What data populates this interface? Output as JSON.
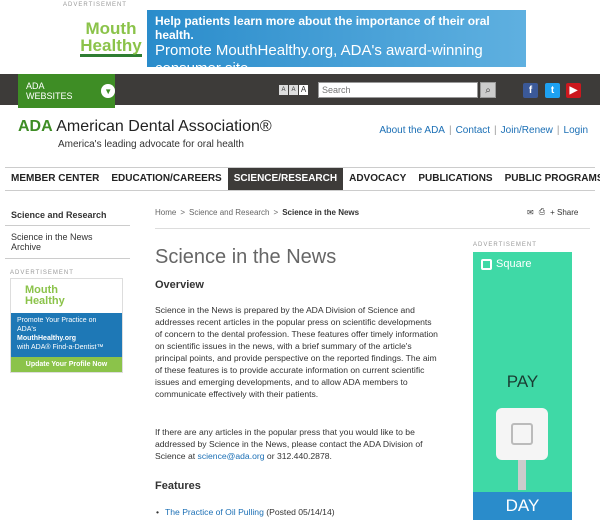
{
  "top_ad": {
    "label": "ADVERTISEMENT",
    "logo_line1": "Mouth",
    "logo_line2": "Healthy",
    "tm": "TM",
    "line1": "Help patients learn more about the importance of their oral health.",
    "line2": "Promote MouthHealthy.org, ADA's award-winning consumer site."
  },
  "utility": {
    "websites_label": "ADA WEBSITES",
    "text_sizes": [
      "A",
      "A",
      "A"
    ],
    "search_placeholder": "Search",
    "social": [
      "f",
      "t",
      "▶"
    ]
  },
  "header": {
    "logo_short": "ADA",
    "logo_name": "American Dental Association®",
    "tagline": "America's leading advocate for oral health",
    "links": [
      "About the ADA",
      "Contact",
      "Join/Renew",
      "Login"
    ]
  },
  "nav": {
    "items": [
      "MEMBER CENTER",
      "EDUCATION/CAREERS",
      "SCIENCE/RESEARCH",
      "ADVOCACY",
      "PUBLICATIONS",
      "PUBLIC PROGRAMS"
    ],
    "active_index": 2
  },
  "sidebar": {
    "title": "Science and Research",
    "items": [
      "Science in the News Archive"
    ]
  },
  "left_ad": {
    "label": "ADVERTISEMENT",
    "logo_line1": "Mouth",
    "logo_line2": "Healthy",
    "body1": "Promote Your Practice on ADA's",
    "body2": "MouthHealthy.org",
    "body3": "with ADA® Find-a-Dentist™",
    "cta": "Update Your Profile Now"
  },
  "breadcrumb": [
    "Home",
    "Science and Research",
    "Science in the News"
  ],
  "page_tools": {
    "share_label": "Share"
  },
  "content": {
    "title": "Science in the News",
    "overview_heading": "Overview",
    "overview_text": "Science in the News is prepared by the ADA Division of Science and addresses recent articles in the popular press on scientific developments of concern to the dental profession. These features offer timely information on scientific issues in the news, with a brief summary of the article's principal points, and provide perspective on the reported findings. The aim of these features is to provide accurate information on current scientific issues and emerging developments, and to allow ADA members to communicate effectively with their patients.",
    "contact_text_before": "If there are any articles in the popular press that you would like to be addressed by Science in the News, please contact the ADA Division of Science at ",
    "contact_email": "science@ada.org",
    "contact_text_after": " or 312.440.2878.",
    "features_heading": "Features",
    "feature_link": "The Practice of Oil Pulling",
    "feature_date": " (Posted 05/14/14)"
  },
  "right_ad": {
    "label": "ADVERTISEMENT",
    "brand": "Square",
    "pay": "PAY",
    "day": "DAY"
  }
}
